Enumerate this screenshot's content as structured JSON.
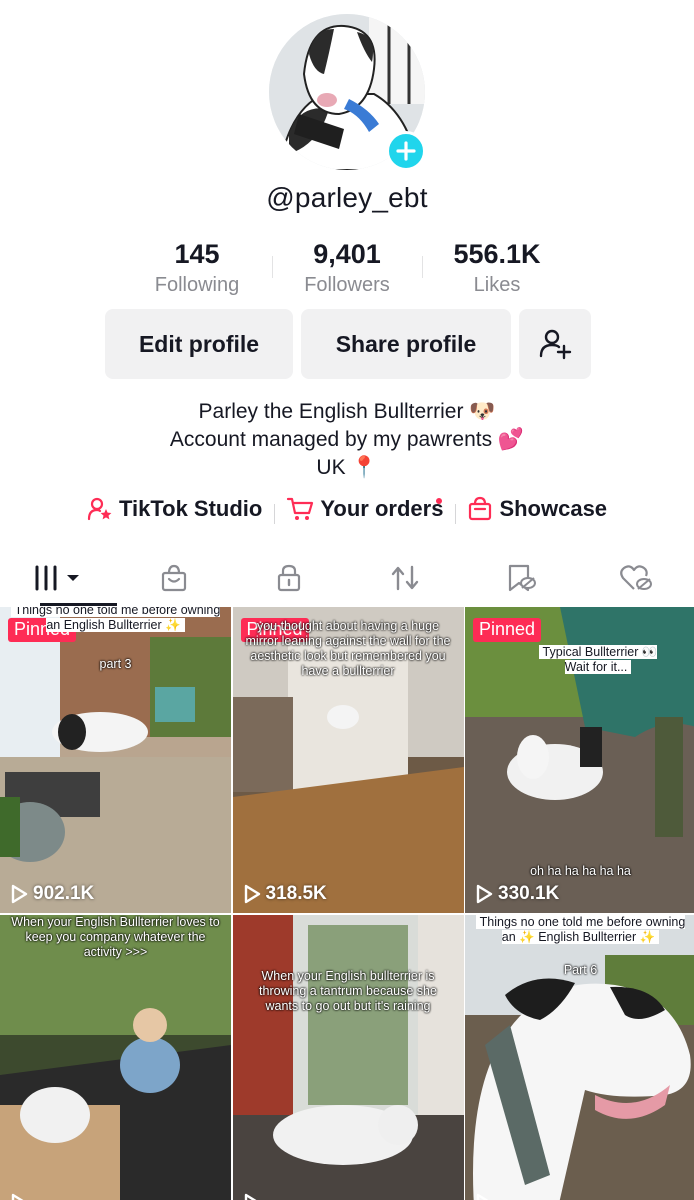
{
  "profile": {
    "username": "@parley_ebt",
    "stats": [
      {
        "value": "145",
        "label": "Following"
      },
      {
        "value": "9,401",
        "label": "Followers"
      },
      {
        "value": "556.1K",
        "label": "Likes"
      }
    ],
    "buttons": {
      "edit": "Edit profile",
      "share": "Share profile"
    },
    "bio": [
      "Parley the English Bullterrier 🐶",
      "Account managed by my pawrents 💕",
      "UK 📍"
    ]
  },
  "links": [
    {
      "label": "TikTok Studio",
      "icon": "person-star-icon"
    },
    {
      "label": "Your orders",
      "icon": "cart-icon",
      "notification": true
    },
    {
      "label": "Showcase",
      "icon": "shopping-bag-icon"
    }
  ],
  "tabs": [
    {
      "name": "videos-grid-icon",
      "active": true
    },
    {
      "name": "shop-icon"
    },
    {
      "name": "private-lock-icon"
    },
    {
      "name": "reposts-icon"
    },
    {
      "name": "favorites-icon"
    },
    {
      "name": "liked-hidden-icon"
    }
  ],
  "videos": [
    {
      "pinned": "Pinned",
      "caption": "Things no one told me before owning an English Bullterrier ✨",
      "caption2": "part 3",
      "views": "902.1K"
    },
    {
      "pinned": "Pinned",
      "caption": "you thought about having a huge mirror leaning against the wall for the aesthetic look but remembered you have a bullterrier",
      "views": "318.5K"
    },
    {
      "pinned": "Pinned",
      "caption": "Typical Bullterrier 👀 Wait for it...",
      "caption2": "oh ha ha ha ha ha",
      "views": "330.1K"
    },
    {
      "caption": "When your English Bullterrier loves to keep you company whatever the activity >>>",
      "views": ""
    },
    {
      "caption": "When your English bullterrier is throwing a tantrum because she wants to go out but it's raining",
      "views": ""
    },
    {
      "caption": "Things no one told me before owning an ✨ English Bullterrier ✨",
      "caption2": "Part 6",
      "views": ""
    }
  ],
  "colors": {
    "accent": "#fe2c55",
    "badge": "#20d5ec",
    "button_bg": "#f1f1f2",
    "muted": "#8a8b91"
  }
}
